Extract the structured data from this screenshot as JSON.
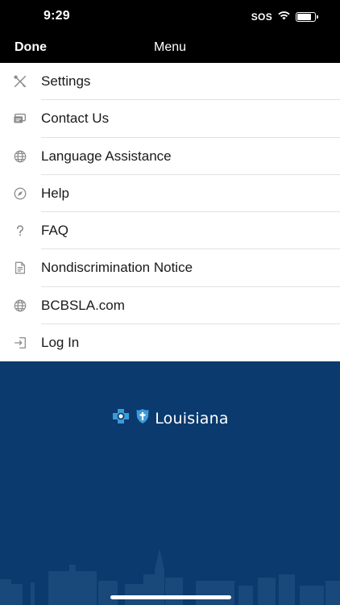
{
  "status_bar": {
    "time": "9:29",
    "sos": "SOS",
    "battery_level": 0.85
  },
  "nav": {
    "done_label": "Done",
    "title": "Menu"
  },
  "menu": {
    "items": [
      {
        "label": "Settings",
        "icon": "tools-icon"
      },
      {
        "label": "Contact Us",
        "icon": "contact-card-icon"
      },
      {
        "label": "Language Assistance",
        "icon": "globe-icon"
      },
      {
        "label": "Help",
        "icon": "compass-icon"
      },
      {
        "label": "FAQ",
        "icon": "question-icon"
      },
      {
        "label": "Nondiscrimination Notice",
        "icon": "document-icon"
      },
      {
        "label": "BCBSLA.com",
        "icon": "globe-icon"
      },
      {
        "label": "Log In",
        "icon": "login-icon"
      }
    ]
  },
  "brand": {
    "logo_text": "Louisiana",
    "background_color": "#0a3a6e"
  }
}
